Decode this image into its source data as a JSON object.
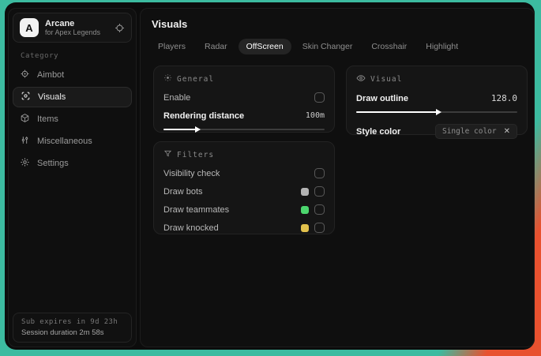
{
  "colors": {
    "backdrop_teal": "#3cbba0",
    "backdrop_orange": "#e8512f",
    "accent_white": "#ffffff"
  },
  "app": {
    "logo_letter": "A",
    "name": "Arcane",
    "subtitle": "for Apex Legends"
  },
  "sidebar": {
    "category_label": "Category",
    "items": [
      {
        "label": "Aimbot"
      },
      {
        "label": "Visuals"
      },
      {
        "label": "Items"
      },
      {
        "label": "Miscellaneous"
      },
      {
        "label": "Settings"
      }
    ],
    "footer": {
      "sub_expiry": "Sub expires in 9d 23h",
      "session_duration": "Session duration 2m 58s"
    }
  },
  "main": {
    "title": "Visuals",
    "tabs": [
      {
        "label": "Players"
      },
      {
        "label": "Radar"
      },
      {
        "label": "OffScreen"
      },
      {
        "label": "Skin Changer"
      },
      {
        "label": "Crosshair"
      },
      {
        "label": "Highlight"
      }
    ],
    "general": {
      "title": "General",
      "enable_label": "Enable",
      "distance_label": "Rendering distance",
      "distance_value": "100m",
      "distance_fill_pct": 22
    },
    "filters": {
      "title": "Filters",
      "rows": [
        {
          "label": "Visibility check"
        },
        {
          "label": "Draw bots",
          "swatch": "#b4b4b4"
        },
        {
          "label": "Draw teammates",
          "swatch": "#4cd66e"
        },
        {
          "label": "Draw knocked",
          "swatch": "#e2c14c"
        }
      ]
    },
    "visual": {
      "title": "Visual",
      "outline_label": "Draw outline",
      "outline_value": "128.0",
      "outline_fill_pct": 52,
      "style_label": "Style color",
      "style_value": "Single color",
      "clear_glyph": "✕"
    }
  }
}
